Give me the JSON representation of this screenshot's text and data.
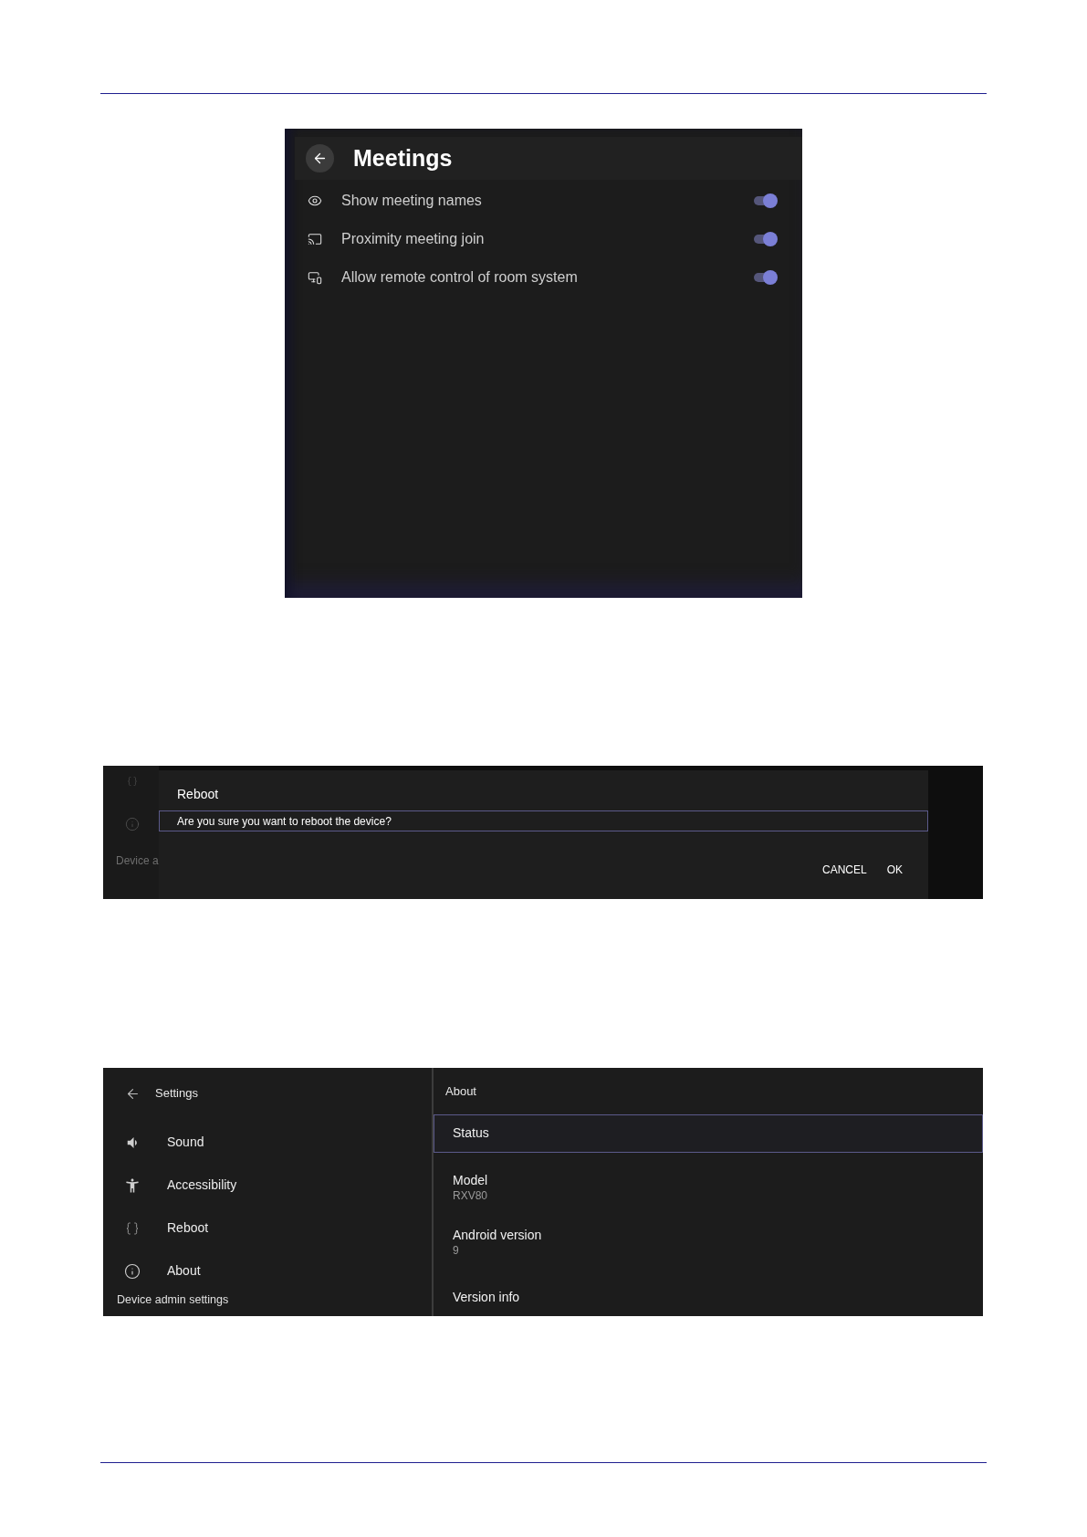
{
  "meetings": {
    "title": "Meetings",
    "settings": [
      {
        "label": "Show meeting names",
        "on": true
      },
      {
        "label": "Proximity meeting join",
        "on": true
      },
      {
        "label": "Allow remote control of room system",
        "on": true
      }
    ]
  },
  "reboot_dialog": {
    "background_sidebar": {
      "label": "Device a"
    },
    "title": "Reboot",
    "message": "Are you sure you want to reboot the device?",
    "buttons": [
      "CANCEL",
      "OK"
    ]
  },
  "settings_screen": {
    "sidebar": {
      "title": "Settings",
      "items": [
        {
          "label": "Sound"
        },
        {
          "label": "Accessibility"
        },
        {
          "label": "Reboot"
        },
        {
          "label": "About"
        }
      ],
      "section_label": "Device admin settings"
    },
    "detail": {
      "title": "About",
      "items": [
        {
          "label": "Status",
          "selected": true
        },
        {
          "label": "Model",
          "value": "RXV80",
          "selected": false
        },
        {
          "label": "Android version",
          "value": "9",
          "selected": false
        },
        {
          "label": "Version info",
          "selected": false
        }
      ]
    }
  }
}
